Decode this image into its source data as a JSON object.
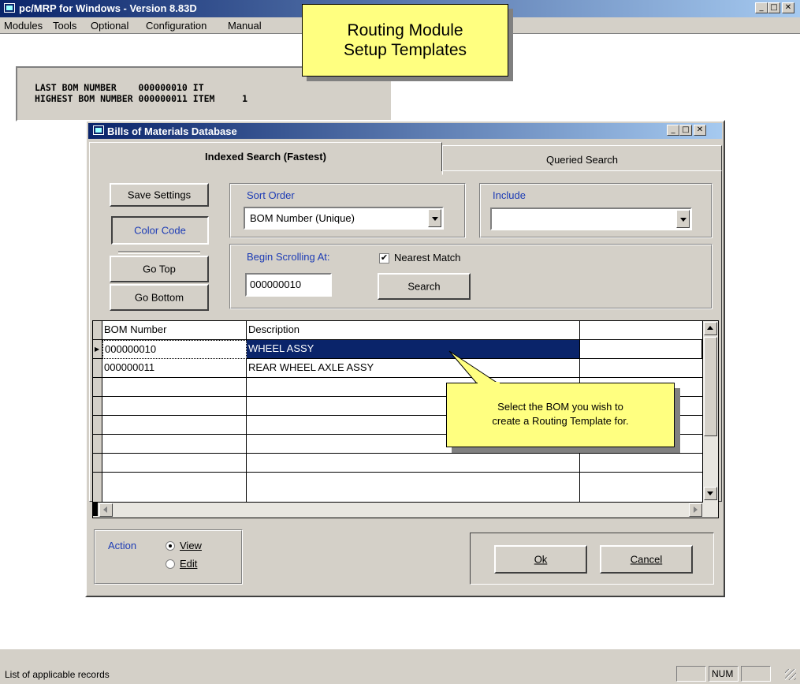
{
  "main_window": {
    "title": "pc/MRP for Windows - Version 8.83D",
    "menu": [
      "Modules",
      "Tools",
      "Optional",
      "Configuration",
      "Manual"
    ]
  },
  "bom_info": {
    "line1": "LAST BOM NUMBER    000000010 IT",
    "line2": "HIGHEST BOM NUMBER 000000011 ITEM     1"
  },
  "callout_title": {
    "line1": "Routing Module",
    "line2": "Setup Templates"
  },
  "dialog": {
    "title": "Bills of Materials Database",
    "tabs": [
      "Indexed Search (Fastest)",
      "Queried Search"
    ],
    "buttons": {
      "save_settings": "Save Settings",
      "color_code": "Color Code",
      "go_top": "Go Top",
      "go_bottom": "Go Bottom"
    },
    "sort_order": {
      "label": "Sort Order",
      "value": "BOM Number (Unique)"
    },
    "include": {
      "label": "Include",
      "value": ""
    },
    "begin_scrolling": {
      "label": "Begin Scrolling At:",
      "value": "000000010"
    },
    "nearest_match": {
      "label": "Nearest Match",
      "checked": true
    },
    "search_button": "Search",
    "grid": {
      "columns": [
        "BOM Number",
        "Description"
      ],
      "rows": [
        {
          "bom": "000000010",
          "desc": "WHEEL ASSY",
          "selected": true
        },
        {
          "bom": "000000011",
          "desc": "REAR WHEEL AXLE ASSY",
          "selected": false
        }
      ]
    },
    "action": {
      "label": "Action",
      "options": [
        "View",
        "Edit"
      ],
      "selected": "View"
    },
    "ok": "Ok",
    "cancel": "Cancel"
  },
  "callout_select": {
    "line1": "Select the BOM you wish to",
    "line2": "create a Routing Template for."
  },
  "status": {
    "text": "List of applicable records",
    "num": "NUM"
  }
}
